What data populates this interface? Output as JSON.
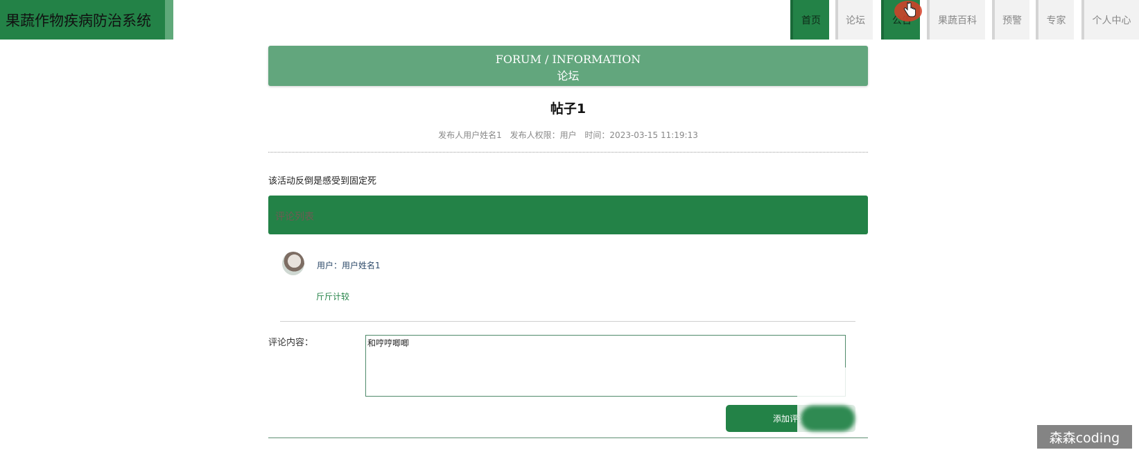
{
  "header": {
    "title": "果蔬作物疾病防治系统",
    "nav": [
      {
        "label": "首页",
        "active": true
      },
      {
        "label": "论坛",
        "active": false
      },
      {
        "label": "公告",
        "active": true
      },
      {
        "label": "果蔬百科",
        "active": false
      },
      {
        "label": "预警",
        "active": false
      },
      {
        "label": "专家",
        "active": false
      },
      {
        "label": "个人中心",
        "active": false
      }
    ]
  },
  "banner": {
    "en": "FORUM / INFORMATION",
    "cn": "论坛"
  },
  "post": {
    "title": "帖子1",
    "meta_author": "发布人用户姓名1",
    "meta_role": "发布人权限：用户",
    "meta_time": "时间：2023-03-15 11:19:13",
    "content": "该活动反倒是感受到固定死"
  },
  "comments": {
    "header_label": "评论列表",
    "items": [
      {
        "user": "用户：用户姓名1",
        "text": "斤斤计较"
      }
    ]
  },
  "form": {
    "label": "评论内容：",
    "value": "和哼哼唧唧",
    "button": "添加评论"
  },
  "watermark": "森森coding",
  "colors": {
    "primary": "#238247",
    "banner": "#62a67d"
  }
}
